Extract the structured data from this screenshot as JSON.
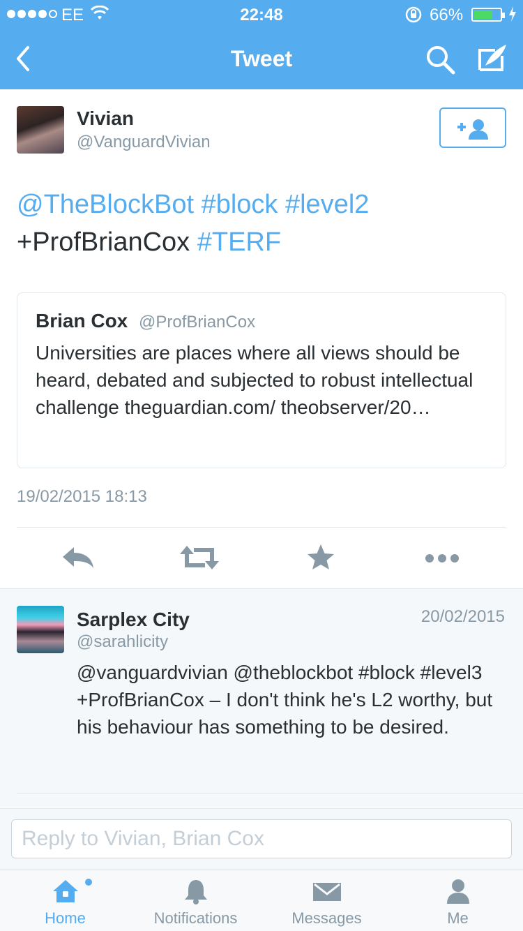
{
  "status_bar": {
    "carrier": "EE",
    "time": "22:48",
    "battery": "66%",
    "battery_level": 0.66,
    "signal_bars_filled": 4,
    "signal_bars_total": 5
  },
  "nav": {
    "title": "Tweet",
    "icons": [
      "back-chevron-icon",
      "search-icon",
      "compose-icon"
    ]
  },
  "tweet": {
    "author_name": "Vivian",
    "author_handle": "@VanguardVivian",
    "text_parts": {
      "mention": "@TheBlockBot",
      "tag1": "#block",
      "tag2": "#level2",
      "plain": "+ProfBrianCox",
      "tag3": "#TERF"
    },
    "timestamp": "19/02/2015 18:13",
    "follow_icon": "add-user-icon"
  },
  "quoted": {
    "name": "Brian Cox",
    "handle": "@ProfBrianCox",
    "text": "Universities are places where all views should be heard, debated and subjected to robust intellectual challenge  theguardian.com/ theobserver/20…"
  },
  "actions": [
    "reply-icon",
    "retweet-icon",
    "favorite-icon",
    "more-icon"
  ],
  "reply": {
    "name": "Sarplex City",
    "handle": "@sarahlicity",
    "date": "20/02/2015",
    "text": "@vanguardvivian @theblockbot #block #level3 +ProfBrianCox – I don't think he's L2 worthy, but his behaviour has something to be desired."
  },
  "reply_input": {
    "placeholder": "Reply to Vivian, Brian Cox",
    "value": ""
  },
  "tabs": [
    {
      "label": "Home",
      "icon": "home-icon",
      "active": true
    },
    {
      "label": "Notifications",
      "icon": "bell-icon",
      "active": false
    },
    {
      "label": "Messages",
      "icon": "envelope-icon",
      "active": false
    },
    {
      "label": "Me",
      "icon": "person-icon",
      "active": false
    }
  ],
  "colors": {
    "brand": "#55acee",
    "text": "#292f33",
    "muted": "#8899a6",
    "border": "#e1e8ed",
    "battery": "#4cd964"
  }
}
